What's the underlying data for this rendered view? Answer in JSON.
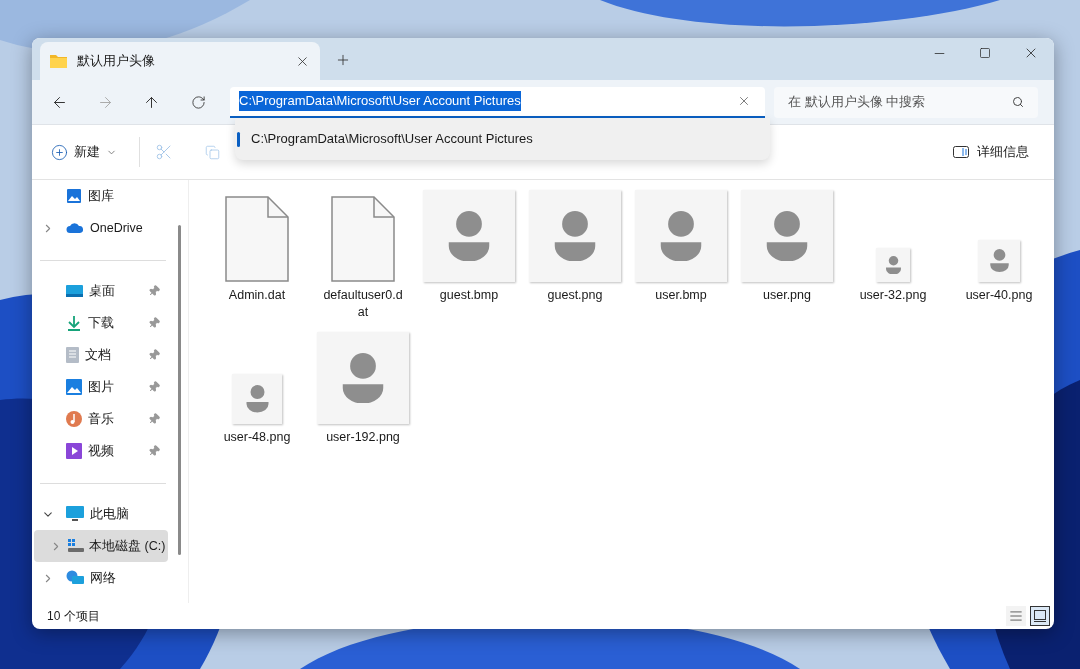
{
  "tab": {
    "title": "默认用户头像",
    "selected": true
  },
  "address": {
    "value": "C:\\ProgramData\\Microsoft\\User Account Pictures",
    "highlighted": true
  },
  "suggestions": [
    {
      "text": "C:\\ProgramData\\Microsoft\\User Account Pictures",
      "selected": true
    }
  ],
  "search": {
    "placeholder": "在 默认用户头像 中搜索"
  },
  "toolbar": {
    "new_button": "新建",
    "cut": {
      "disabled": true
    },
    "copy": {
      "disabled": true
    },
    "details_button": "详细信息"
  },
  "sidebar": {
    "sections": [
      [
        {
          "label": "图库"
        },
        {
          "label": "OneDrive",
          "expanded": false
        }
      ],
      [
        {
          "label": "桌面",
          "pinned": true
        },
        {
          "label": "下载",
          "pinned": true
        },
        {
          "label": "文档",
          "pinned": true
        },
        {
          "label": "图片",
          "pinned": true
        },
        {
          "label": "音乐",
          "pinned": true
        },
        {
          "label": "视频",
          "pinned": true
        }
      ],
      [
        {
          "label": "此电脑",
          "expanded": true,
          "children": [
            {
              "label": "本地磁盘 (C:)",
              "expanded": false,
              "selected": true
            }
          ]
        },
        {
          "label": "网络",
          "expanded": false
        }
      ]
    ]
  },
  "files": [
    {
      "name": "Admin.dat",
      "kind": "document"
    },
    {
      "name": "defaultuser0.dat",
      "kind": "document"
    },
    {
      "name": "guest.bmp",
      "kind": "large"
    },
    {
      "name": "guest.png",
      "kind": "large"
    },
    {
      "name": "user.bmp",
      "kind": "large"
    },
    {
      "name": "user.png",
      "kind": "large"
    },
    {
      "name": "user-32.png",
      "kind": "tiny"
    },
    {
      "name": "user-40.png",
      "kind": "small"
    },
    {
      "name": "user-48.png",
      "kind": "medium"
    },
    {
      "name": "user-192.png",
      "kind": "large"
    }
  ],
  "status_bar": {
    "count": "10 个项目",
    "views": [
      {
        "selected": false
      },
      {
        "selected": true
      }
    ]
  }
}
